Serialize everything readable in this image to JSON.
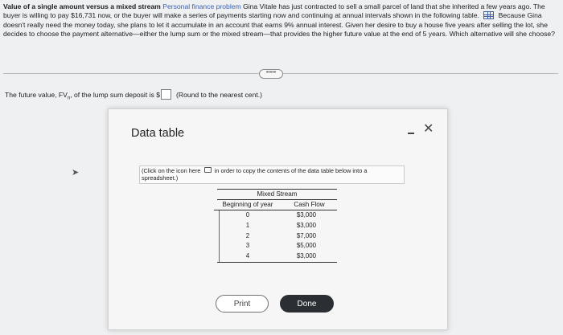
{
  "problem": {
    "bold_title": "Value of a single amount versus a mixed stream",
    "topic": "Personal finance problem",
    "text_part1": "Gina Vitale has just contracted to sell a small parcel of land that she inherited a few years ago. The buyer is willing to pay $16,731 now, or the buyer will make a series of payments starting now and continuing at annual intervals shown in the following table.",
    "text_part2": "Because Gina doesn't really need the money today, she plans to let it accumulate in an account that earns 9% annual interest. Given her desire to buy a house five years after selling the lot, she decides to choose the payment alternative—either the lump sum or the mixed stream—that provides the higher future value at the end of 5 years. Which alternative will she choose?"
  },
  "expand_label": "•••••",
  "question": {
    "prefix": "The future value, FV",
    "subscript": "n",
    "middle": ", of the lump sum deposit is $",
    "hint": "(Round to the nearest cent.)",
    "answer_value": ""
  },
  "dialog": {
    "title": "Data table",
    "info_part1": "(Click on the icon here",
    "info_part2": "in order to copy the contents of the data table below into a spreadsheet.)",
    "table": {
      "caption": "Mixed Stream",
      "headers": [
        "Beginning of year",
        "Cash Flow"
      ],
      "rows": [
        {
          "year": "0",
          "cash": "$3,000"
        },
        {
          "year": "1",
          "cash": "$3,000"
        },
        {
          "year": "2",
          "cash": "$7,000"
        },
        {
          "year": "3",
          "cash": "$5,000"
        },
        {
          "year": "4",
          "cash": "$3,000"
        }
      ]
    },
    "print_label": "Print",
    "done_label": "Done"
  }
}
